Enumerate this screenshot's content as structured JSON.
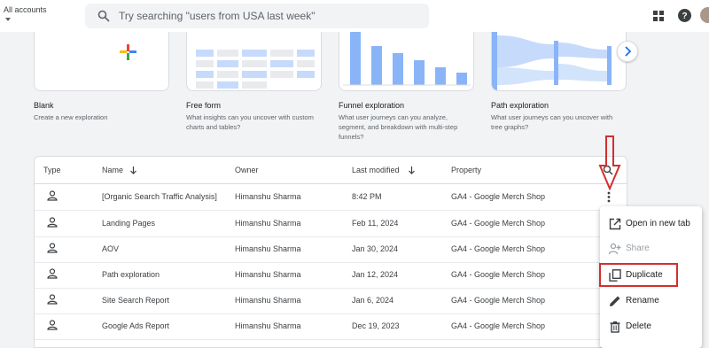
{
  "header": {
    "account_label": "All accounts",
    "search_placeholder": "Try searching \"users from USA last week\""
  },
  "templates": [
    {
      "title": "Blank",
      "desc": "Create a new exploration"
    },
    {
      "title": "Free form",
      "desc": "What insights can you uncover with custom charts and tables?"
    },
    {
      "title": "Funnel exploration",
      "desc": "What user journeys can you analyze, segment, and breakdown with multi-step funnels?"
    },
    {
      "title": "Path exploration",
      "desc": "What user journeys can you uncover with tree graphs?"
    }
  ],
  "table": {
    "headers": {
      "type": "Type",
      "name": "Name",
      "owner": "Owner",
      "modified": "Last modified",
      "property": "Property"
    },
    "rows": [
      {
        "name": "[Organic Search Traffic Analysis]",
        "owner": "Himanshu Sharma",
        "modified": "8:42 PM",
        "property": "GA4 - Google Merch Shop"
      },
      {
        "name": "Landing Pages",
        "owner": "Himanshu Sharma",
        "modified": "Feb 11, 2024",
        "property": "GA4 - Google Merch Shop"
      },
      {
        "name": "AOV",
        "owner": "Himanshu Sharma",
        "modified": "Jan 30, 2024",
        "property": "GA4 - Google Merch Shop"
      },
      {
        "name": "Path exploration",
        "owner": "Himanshu Sharma",
        "modified": "Jan 12, 2024",
        "property": "GA4 - Google Merch Shop"
      },
      {
        "name": "Site Search Report",
        "owner": "Himanshu Sharma",
        "modified": "Jan 6, 2024",
        "property": "GA4 - Google Merch Shop"
      },
      {
        "name": "Google Ads Report",
        "owner": "Himanshu Sharma",
        "modified": "Dec 19, 2023",
        "property": "GA4 - Google Merch Shop"
      }
    ]
  },
  "menu": {
    "items": [
      {
        "label": "Open in new tab",
        "icon": "open-in-new-icon",
        "disabled": false
      },
      {
        "label": "Share",
        "icon": "share-person-icon",
        "disabled": true
      },
      {
        "label": "Duplicate",
        "icon": "duplicate-icon",
        "disabled": false
      },
      {
        "label": "Rename",
        "icon": "pencil-icon",
        "disabled": false
      },
      {
        "label": "Delete",
        "icon": "trash-icon",
        "disabled": false
      }
    ]
  },
  "colors": {
    "accent_blue": "#1a73e8",
    "annotation_red": "#d32f2f",
    "chart_blue": "#8ab4f8"
  }
}
